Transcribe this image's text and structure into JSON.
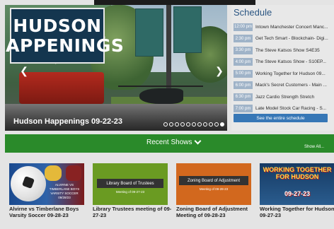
{
  "hero": {
    "logo_line1": "HUDSON",
    "logo_line2": "HAPPENINGS",
    "caption": "Hudson Happenings 09-22-23",
    "prev_icon": "chevron-left-icon",
    "next_icon": "chevron-right-icon",
    "dot_count": 11,
    "active_dot": 10
  },
  "schedule": {
    "title": "Schedule",
    "items": [
      {
        "time": "12:00 pm",
        "title": "Intown Manchester Concert Manc..."
      },
      {
        "time": "2:30 pm",
        "title": "Get Tech Smart - Blockchain- Digi..."
      },
      {
        "time": "3:30 pm",
        "title": "The Steve Katsos Show S4E35"
      },
      {
        "time": "4:00 pm",
        "title": "The Steve Katsos Show - S10EP..."
      },
      {
        "time": "5:00 pm",
        "title": "Working Together for Hudson 09..."
      },
      {
        "time": "6:00 pm",
        "title": "Mack's Secret Customers - Main ..."
      },
      {
        "time": "6:30 pm",
        "title": "Jazz Cardio Strength Stretch"
      },
      {
        "time": "7:00 pm",
        "title": "Late Model Stock Car Racing - S..."
      }
    ],
    "button_label": "See the entire schedule"
  },
  "recent": {
    "title": "Recent Shows",
    "show_all": "Show All..."
  },
  "shows": [
    {
      "caption": "Alvirne vs Timberlane Boys Varsity Soccer 09-28-23",
      "thumb_text": "ALVIRNE VS TIMBERLANE BOYS VARSITY SOCCER 09/28/23"
    },
    {
      "caption": "Library Trustees meeting of 09-27-23",
      "thumb_title": "Library Board of Trustees",
      "thumb_sub": "Meeting of 09-27-23"
    },
    {
      "caption": "Zoning Board of Adjustment Meeting of 09-28-23",
      "thumb_title": "Zoning Board of Adjustment",
      "thumb_sub": "Meeting of 09-28-23"
    },
    {
      "caption": "Working Together for Hudson 09-27-23",
      "thumb_l1": "WORKING TOGETHER",
      "thumb_l2": "FOR HUDSON",
      "thumb_l3": "09-27-23"
    }
  ]
}
